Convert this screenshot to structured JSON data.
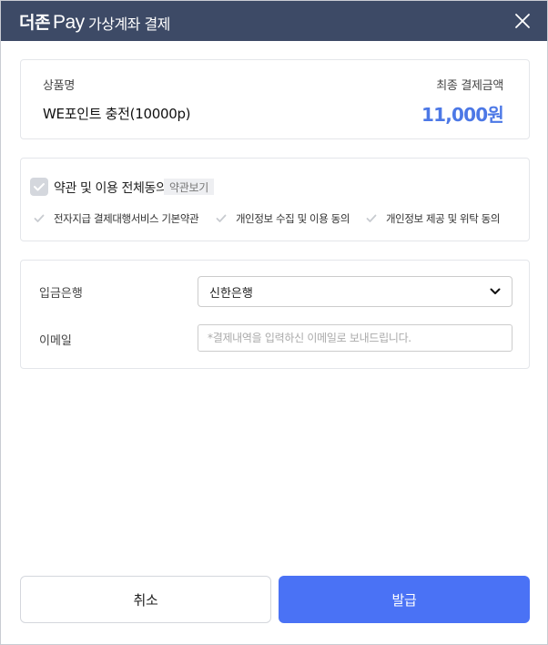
{
  "header": {
    "brand_korean": "더존",
    "brand_pay": "Pay",
    "title": "가상계좌 결제",
    "close_icon": "close-icon"
  },
  "product": {
    "name_label": "상품명",
    "name": "WE포인트 충전(10000p)",
    "amount_label": "최종 결제금액",
    "amount": "11,000원",
    "amount_color": "#4c78e6"
  },
  "terms": {
    "agree_all": "약관 및 이용 전체동의",
    "view_terms": "약관보기",
    "items": [
      "전자지급 결제대행서비스 기본약관",
      "개인정보 수집 및 이용 동의",
      "개인정보 제공 및 위탁 동의"
    ]
  },
  "form": {
    "bank_label": "입금은행",
    "bank_selected": "신한은행",
    "email_label": "이메일",
    "email_placeholder": "*결제내역을 입력하신 이메일로 보내드립니다."
  },
  "buttons": {
    "cancel": "취소",
    "issue": "발급",
    "issue_color": "#4a72f5"
  },
  "colors": {
    "header_bg": "#3d4a66"
  }
}
